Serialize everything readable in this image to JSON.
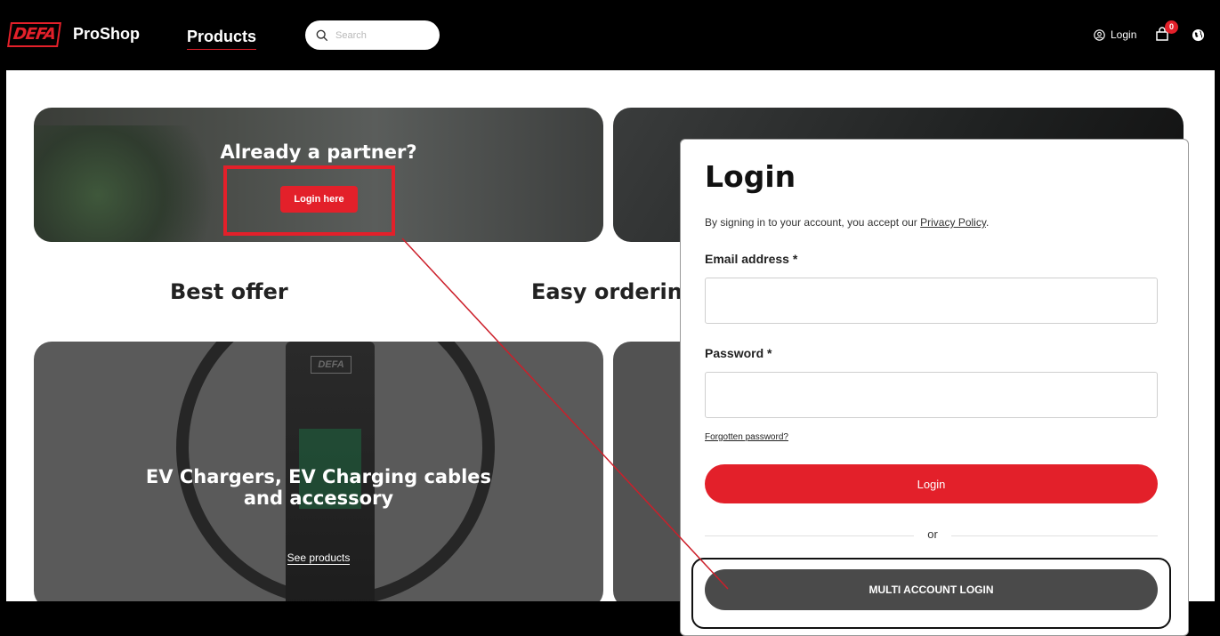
{
  "header": {
    "logo_text": "DEFA",
    "brand": "ProShop",
    "nav_products": "Products",
    "search_placeholder": "Search",
    "login_label": "Login",
    "cart_count": "0"
  },
  "partner_card": {
    "title": "Already a partner?",
    "button": "Login here"
  },
  "sections": {
    "best_offer": "Best offer",
    "easy_ordering": "Easy ordering"
  },
  "ev_card": {
    "logo_text": "DEFA",
    "title_line1": "EV Chargers, EV Charging cables",
    "title_line2": "and accessory",
    "link": "See products"
  },
  "login_modal": {
    "title": "Login",
    "note_prefix": "By signing in to your account, you accept our ",
    "privacy_link": "Privacy Policy",
    "note_suffix": ".",
    "email_label": "Email address *",
    "email_value": "",
    "password_label": "Password *",
    "password_value": "",
    "forgot_link": "Forgotten password?",
    "login_button": "Login",
    "or_text": "or",
    "multi_button": "MULTI ACCOUNT LOGIN"
  },
  "colors": {
    "accent": "#e3202a",
    "dark_button": "#4a4a4a",
    "header_bg": "#000000"
  }
}
